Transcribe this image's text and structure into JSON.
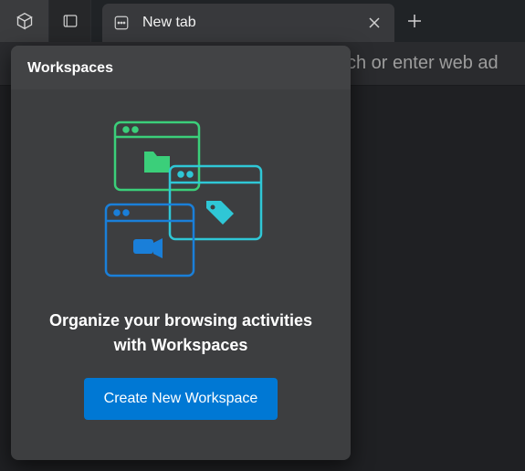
{
  "topbar": {
    "workspaces_icon": "cube-icon",
    "tab_actions_icon": "tab-actions-icon",
    "active_tab": {
      "icon": "new-tab-page-icon",
      "title": "New tab",
      "close": "✕"
    },
    "new_tab": "＋"
  },
  "addressbar": {
    "placeholder_visible_fragment": "ch or enter web ad"
  },
  "workspaces_flyout": {
    "title": "Workspaces",
    "tagline": "Organize your browsing activities with Workspaces",
    "cta_label": "Create New Workspace",
    "illustration_colors": {
      "green": "#3bcf7a",
      "cyan": "#2fc7d6",
      "blue": "#1a7fd9"
    }
  }
}
